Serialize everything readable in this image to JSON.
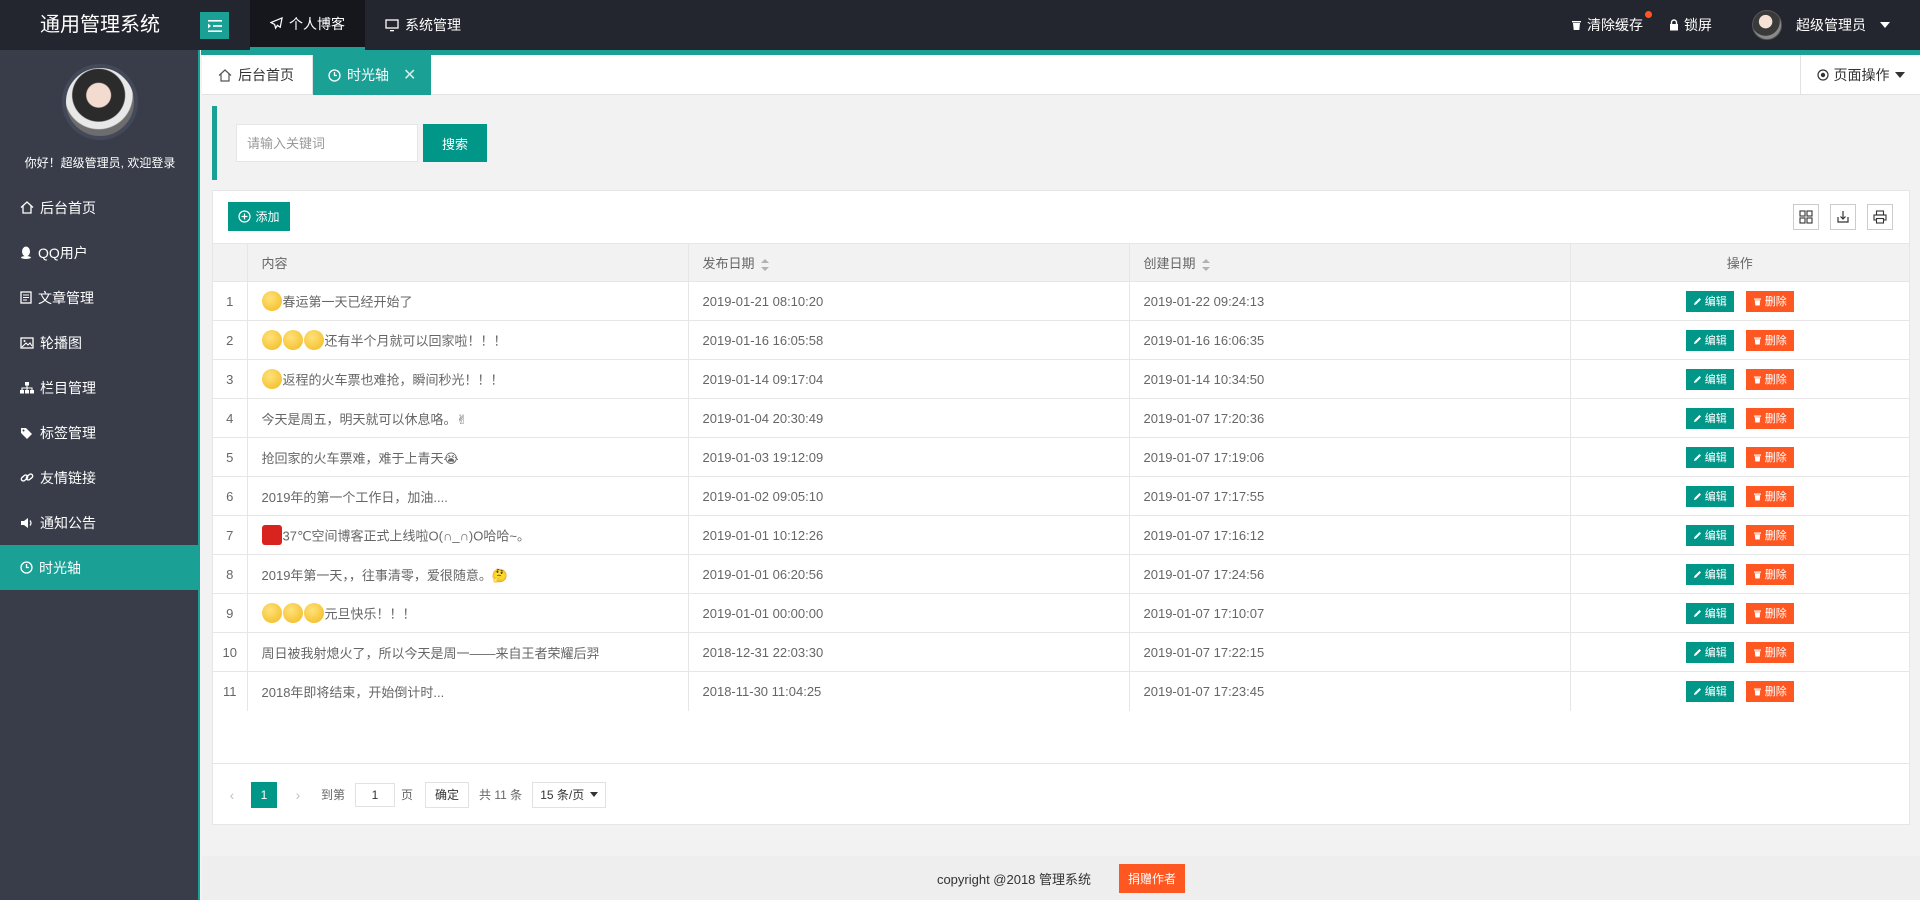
{
  "header": {
    "logo": "通用管理系统",
    "topnav": [
      {
        "label": "个人博客",
        "icon": "paper-plane-icon",
        "active": true
      },
      {
        "label": "系统管理",
        "icon": "monitor-icon",
        "active": false
      }
    ],
    "clear_cache": "清除缓存",
    "lock_screen": "锁屏",
    "user_name": "超级管理员"
  },
  "sidebar": {
    "welcome": "你好！超级管理员, 欢迎登录",
    "items": [
      {
        "label": "后台首页",
        "icon": "home-icon"
      },
      {
        "label": "QQ用户",
        "icon": "qq-icon"
      },
      {
        "label": "文章管理",
        "icon": "document-icon"
      },
      {
        "label": "轮播图",
        "icon": "image-icon"
      },
      {
        "label": "栏目管理",
        "icon": "sitemap-icon"
      },
      {
        "label": "标签管理",
        "icon": "tags-icon"
      },
      {
        "label": "友情链接",
        "icon": "link-icon"
      },
      {
        "label": "通知公告",
        "icon": "volume-icon"
      },
      {
        "label": "时光轴",
        "icon": "clock-icon",
        "active": true
      }
    ]
  },
  "tabs": {
    "home": "后台首页",
    "active": "时光轴",
    "page_ops": "页面操作"
  },
  "search": {
    "placeholder": "请输入关键词",
    "button": "搜索"
  },
  "table": {
    "add_button": "添加",
    "columns": [
      "",
      "内容",
      "发布日期",
      "创建日期",
      "操作"
    ],
    "edit_label": "编辑",
    "delete_label": "删除",
    "rows": [
      {
        "no": "1",
        "emoji": 1,
        "content": "春运第一天已经开始了",
        "publish": "2019-01-21 08:10:20",
        "created": "2019-01-22 09:24:13"
      },
      {
        "no": "2",
        "emoji": 3,
        "content": "还有半个月就可以回家啦！！！",
        "publish": "2019-01-16 16:05:58",
        "created": "2019-01-16 16:06:35"
      },
      {
        "no": "3",
        "emoji": 1,
        "content": "返程的火车票也难抢，瞬间秒光！！！",
        "publish": "2019-01-14 09:17:04",
        "created": "2019-01-14 10:34:50"
      },
      {
        "no": "4",
        "emoji": 0,
        "content": "今天是周五，明天就可以休息咯。✌",
        "publish": "2019-01-04 20:30:49",
        "created": "2019-01-07 17:20:36"
      },
      {
        "no": "5",
        "emoji": 0,
        "content": "抢回家的火车票难，难于上青天😭",
        "publish": "2019-01-03 19:12:09",
        "created": "2019-01-07 17:19:06"
      },
      {
        "no": "6",
        "emoji": 0,
        "content": "2019年的第一个工作日，加油....",
        "publish": "2019-01-02 09:05:10",
        "created": "2019-01-07 17:17:55"
      },
      {
        "no": "7",
        "emoji": "red",
        "content": "37℃空间博客正式上线啦O(∩_∩)O哈哈~。",
        "publish": "2019-01-01 10:12:26",
        "created": "2019-01-07 17:16:12"
      },
      {
        "no": "8",
        "emoji": 0,
        "content": "2019年第一天，，往事清零，爱很随意。🤔",
        "publish": "2019-01-01 06:20:56",
        "created": "2019-01-07 17:24:56"
      },
      {
        "no": "9",
        "emoji": 3,
        "content": "元旦快乐！！！",
        "publish": "2019-01-01 00:00:00",
        "created": "2019-01-07 17:10:07"
      },
      {
        "no": "10",
        "emoji": 0,
        "content": "周日被我射熄火了，所以今天是周一——来自王者荣耀后羿",
        "publish": "2018-12-31 22:03:30",
        "created": "2019-01-07 17:22:15"
      },
      {
        "no": "11",
        "emoji": 0,
        "content": "2018年即将结束，开始倒计时...",
        "publish": "2018-11-30 11:04:25",
        "created": "2019-01-07 17:23:45"
      }
    ]
  },
  "pager": {
    "current": "1",
    "goto_label": "到第",
    "page_value": "1",
    "page_unit": "页",
    "confirm": "确定",
    "total": "共 11 条",
    "page_size": "15 条/页"
  },
  "footer": {
    "copyright": "copyright @2018 管理系统",
    "donate": "捐赠作者"
  },
  "colors": {
    "accent": "#009688",
    "danger": "#ff5722",
    "header_bg": "#23262e",
    "sidebar_bg": "#393d49"
  }
}
